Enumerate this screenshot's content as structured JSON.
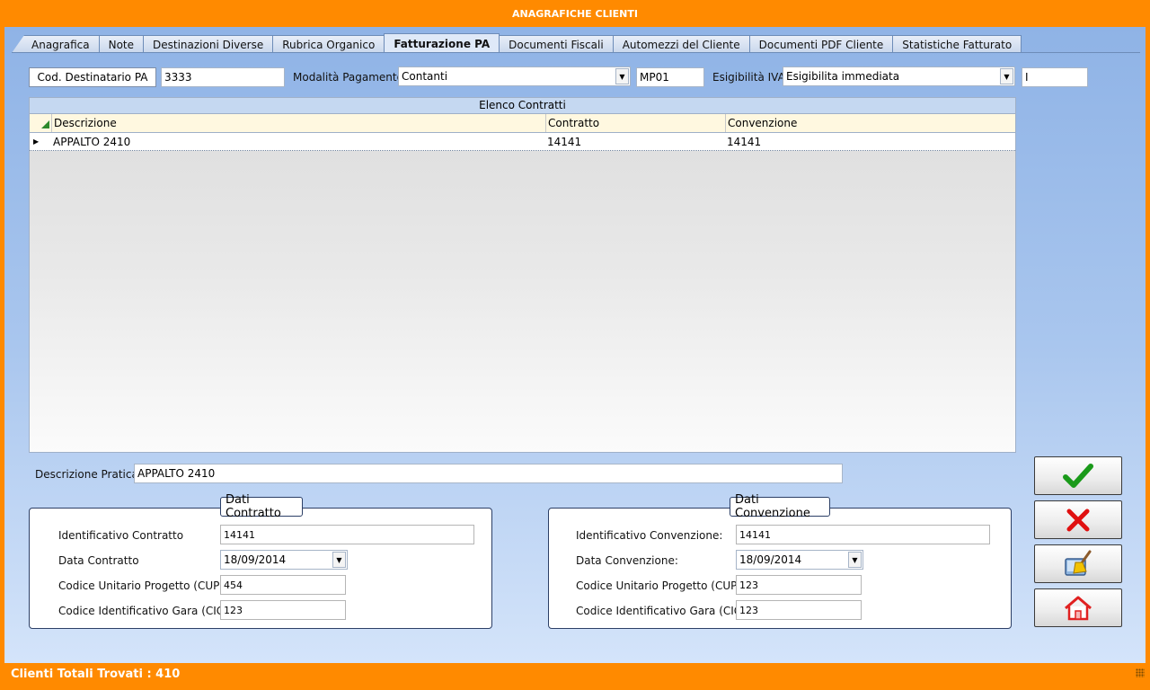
{
  "window": {
    "title": "ANAGRAFICHE CLIENTI"
  },
  "tabs": [
    {
      "label": "Anagrafica"
    },
    {
      "label": "Note"
    },
    {
      "label": "Destinazioni Diverse"
    },
    {
      "label": "Rubrica Organico"
    },
    {
      "label": "Fatturazione PA",
      "active": true
    },
    {
      "label": "Documenti Fiscali"
    },
    {
      "label": "Automezzi del Cliente"
    },
    {
      "label": "Documenti PDF Cliente"
    },
    {
      "label": "Statistiche Fatturato"
    }
  ],
  "header_fields": {
    "cod_dest_label": "Cod. Destinatario PA",
    "cod_dest_value": "3333",
    "modalita_label": "Modalità Pagamento",
    "modalita_value": "Contanti",
    "modalita_code": "MP01",
    "esigibilita_label": "Esigibilità IVA",
    "esigibilita_value": "Esigibilita immediata",
    "esigibilita_code": "I"
  },
  "grid": {
    "caption": "Elenco Contratti",
    "columns": [
      "Descrizione",
      "Contratto",
      "Convenzione"
    ],
    "rows": [
      [
        "APPALTO 2410",
        "14141",
        "14141"
      ]
    ]
  },
  "pratica": {
    "label": "Descrizione Pratica",
    "value": "APPALTO 2410"
  },
  "dati_contratto": {
    "title": "Dati Contratto",
    "id_label": "Identificativo Contratto",
    "id_value": "14141",
    "data_label": "Data Contratto",
    "data_value": "18/09/2014",
    "cup_label": "Codice Unitario Progetto (CUP):",
    "cup_value": "454",
    "cig_label": "Codice Identificativo Gara (CIG):",
    "cig_value": "123"
  },
  "dati_convenzione": {
    "title": "Dati Convenzione",
    "id_label": "Identificativo Convenzione:",
    "id_value": "14141",
    "data_label": "Data Convenzione:",
    "data_value": "18/09/2014",
    "cup_label": "Codice Unitario Progetto (CUP):",
    "cup_value": "123",
    "cig_label": "Codice Identificativo Gara (CIG):",
    "cig_value": "123"
  },
  "actions": {
    "confirm_icon": "checkmark-icon",
    "cancel_icon": "cross-icon",
    "clear_icon": "broom-icon",
    "home_icon": "home-icon",
    "confirm_color": "#1a9a1a",
    "cancel_color": "#e01010"
  },
  "status": {
    "text": "Clienti Totali Trovati : 410"
  },
  "colors": {
    "accent": "#ff8a00",
    "background_top": "#8fb3e6",
    "background_bottom": "#d4e4fa"
  }
}
